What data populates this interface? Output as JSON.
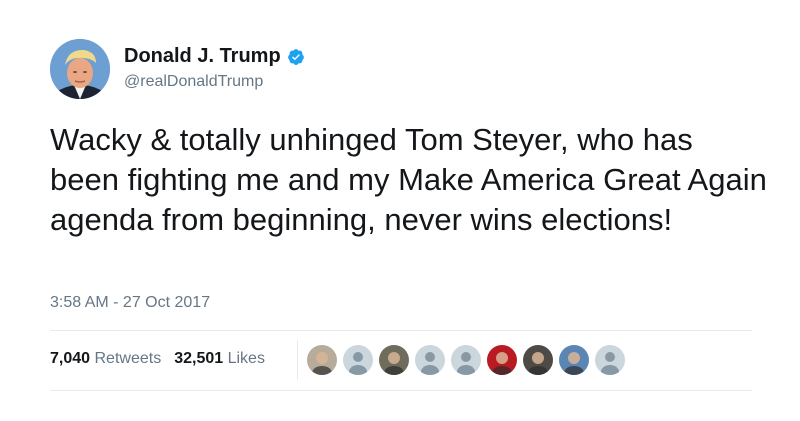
{
  "author": {
    "name": "Donald J. Trump",
    "handle": "@realDonaldTrump",
    "verified_icon": "verified-badge-icon",
    "verified_color": "#1da1f2"
  },
  "tweet": {
    "text": "Wacky & totally unhinged Tom Steyer, who has been fighting me and my Make America Great Again agenda from beginning, never wins elections!",
    "timestamp": "3:58 AM - 27 Oct 2017"
  },
  "stats": {
    "retweets_count": "7,040",
    "retweets_label": "Retweets",
    "likes_count": "32,501",
    "likes_label": "Likes"
  },
  "likers": [
    {
      "kind": "photo",
      "color": "#b7ac9a"
    },
    {
      "kind": "default",
      "color": "#ccd6dd"
    },
    {
      "kind": "photo",
      "color": "#6f6c5c"
    },
    {
      "kind": "default",
      "color": "#ccd6dd"
    },
    {
      "kind": "default",
      "color": "#ccd6dd"
    },
    {
      "kind": "photo",
      "color": "#b81c22"
    },
    {
      "kind": "photo",
      "color": "#4e4a45"
    },
    {
      "kind": "photo",
      "color": "#5b86b4"
    },
    {
      "kind": "default",
      "color": "#ccd6dd"
    }
  ],
  "colors": {
    "text": "#14171a",
    "secondary": "#657786",
    "divider": "#e6ecf0"
  }
}
